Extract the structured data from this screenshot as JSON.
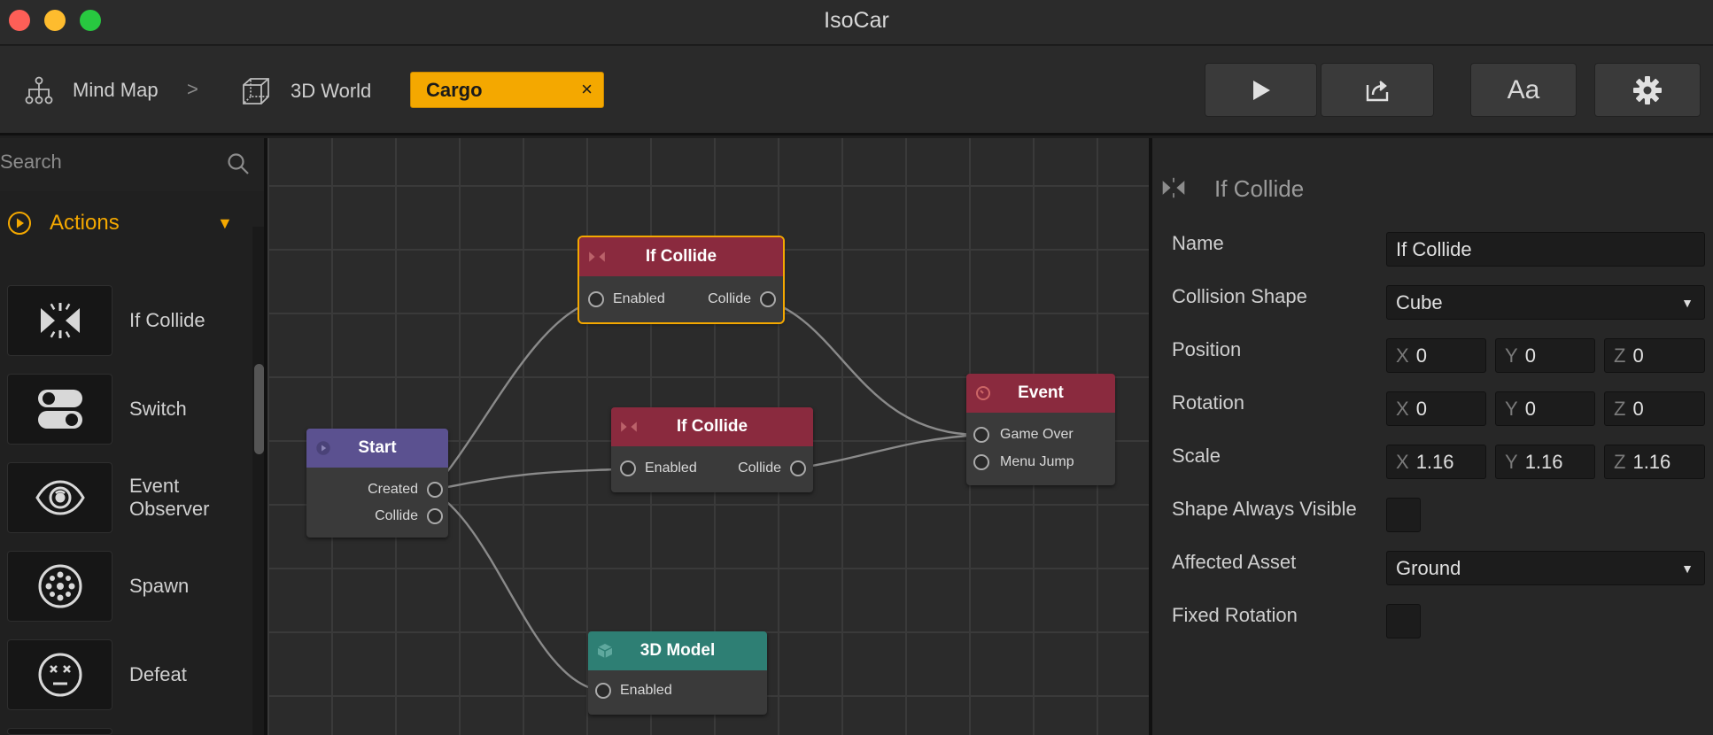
{
  "window": {
    "title": "IsoCar"
  },
  "toolbar": {
    "breadcrumbs": [
      {
        "label": "Mind Map",
        "icon": "hierarchy-icon"
      },
      {
        "label": "3D World",
        "icon": "cube-outline-icon"
      }
    ],
    "separator": ">",
    "active_tab": {
      "label": "Cargo",
      "close": "×"
    },
    "buttons": {
      "font": "Aa"
    }
  },
  "sidebar": {
    "search_placeholder": "Search",
    "section": {
      "label": "Actions",
      "arrow": "▼"
    },
    "items": [
      {
        "label": "If Collide",
        "icon": "collide-icon"
      },
      {
        "label": "Switch",
        "icon": "switch-icon"
      },
      {
        "label": "Event Observer",
        "icon": "eye-icon"
      },
      {
        "label": "Spawn",
        "icon": "spawn-icon"
      },
      {
        "label": "Defeat",
        "icon": "defeat-face-icon"
      }
    ]
  },
  "graph": {
    "nodes": {
      "collide_top": {
        "title": "If Collide",
        "in": "Enabled",
        "out": "Collide"
      },
      "collide_mid": {
        "title": "If Collide",
        "in": "Enabled",
        "out": "Collide"
      },
      "start": {
        "title": "Start",
        "out1": "Created",
        "out2": "Collide"
      },
      "event": {
        "title": "Event",
        "in1": "Game Over",
        "in2": "Menu Jump"
      },
      "model": {
        "title": "3D Model",
        "in": "Enabled"
      }
    },
    "colors": {
      "collide": "#8a2a3e",
      "start": "#5b5190",
      "model": "#2e7f74",
      "selection": "#f4a800"
    }
  },
  "inspector": {
    "title": "If Collide",
    "name_label": "Name",
    "name_value": "If Collide",
    "shape_label": "Collision Shape",
    "shape_value": "Cube",
    "position_label": "Position",
    "position": {
      "x": "0",
      "y": "0",
      "z": "0"
    },
    "rotation_label": "Rotation",
    "rotation": {
      "x": "0",
      "y": "0",
      "z": "0"
    },
    "scale_label": "Scale",
    "scale": {
      "x": "1.16",
      "y": "1.16",
      "z": "1.16"
    },
    "visible_label": "Shape Always Visible",
    "asset_label": "Affected Asset",
    "asset_value": "Ground",
    "fixed_label": "Fixed Rotation",
    "axis": {
      "x": "X",
      "y": "Y",
      "z": "Z"
    }
  }
}
